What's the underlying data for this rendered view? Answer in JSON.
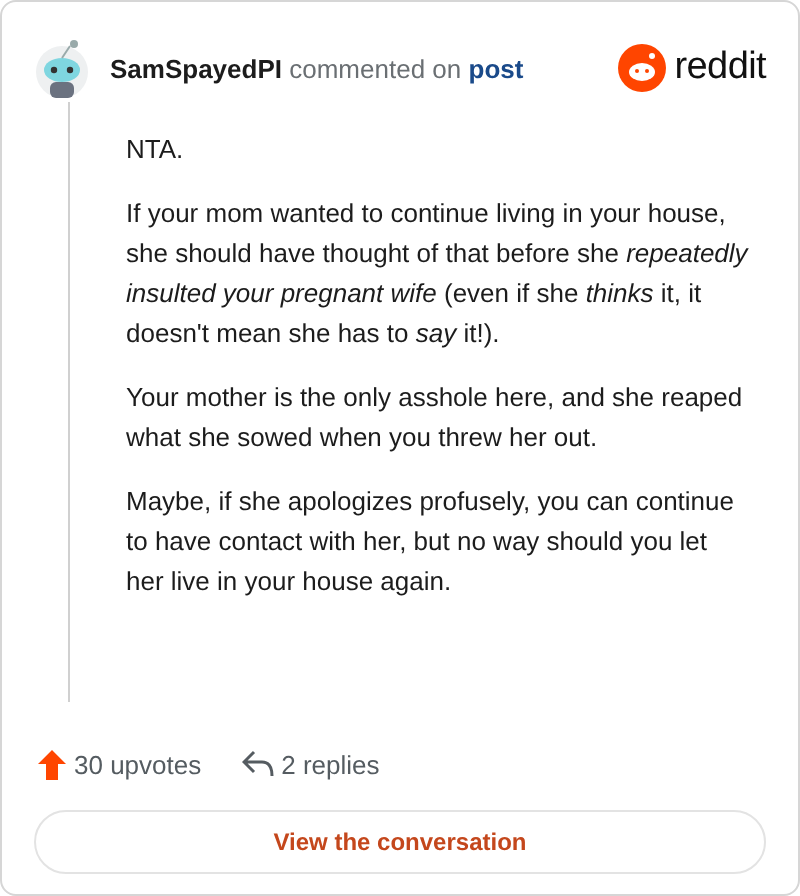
{
  "comment": {
    "author": "SamSpayedPI",
    "action": "commented on",
    "target": "post",
    "brand": "reddit",
    "paragraphs": [
      "NTA.",
      "If your mom wanted to continue living in your house, she should have thought of that before she *repeatedly insulted your pregnant wife* (even if she *thinks* it, it doesn't mean she has to *say* it!).",
      "Your mother is the only asshole here, and she reaped what she sowed when you threw her out.",
      "Maybe, if she apologizes profusely, you can continue to have contact with her, but no way should you let her live in your house again."
    ]
  },
  "stats": {
    "upvotes": "30 upvotes",
    "replies": "2 replies"
  },
  "button": "View the conversation"
}
